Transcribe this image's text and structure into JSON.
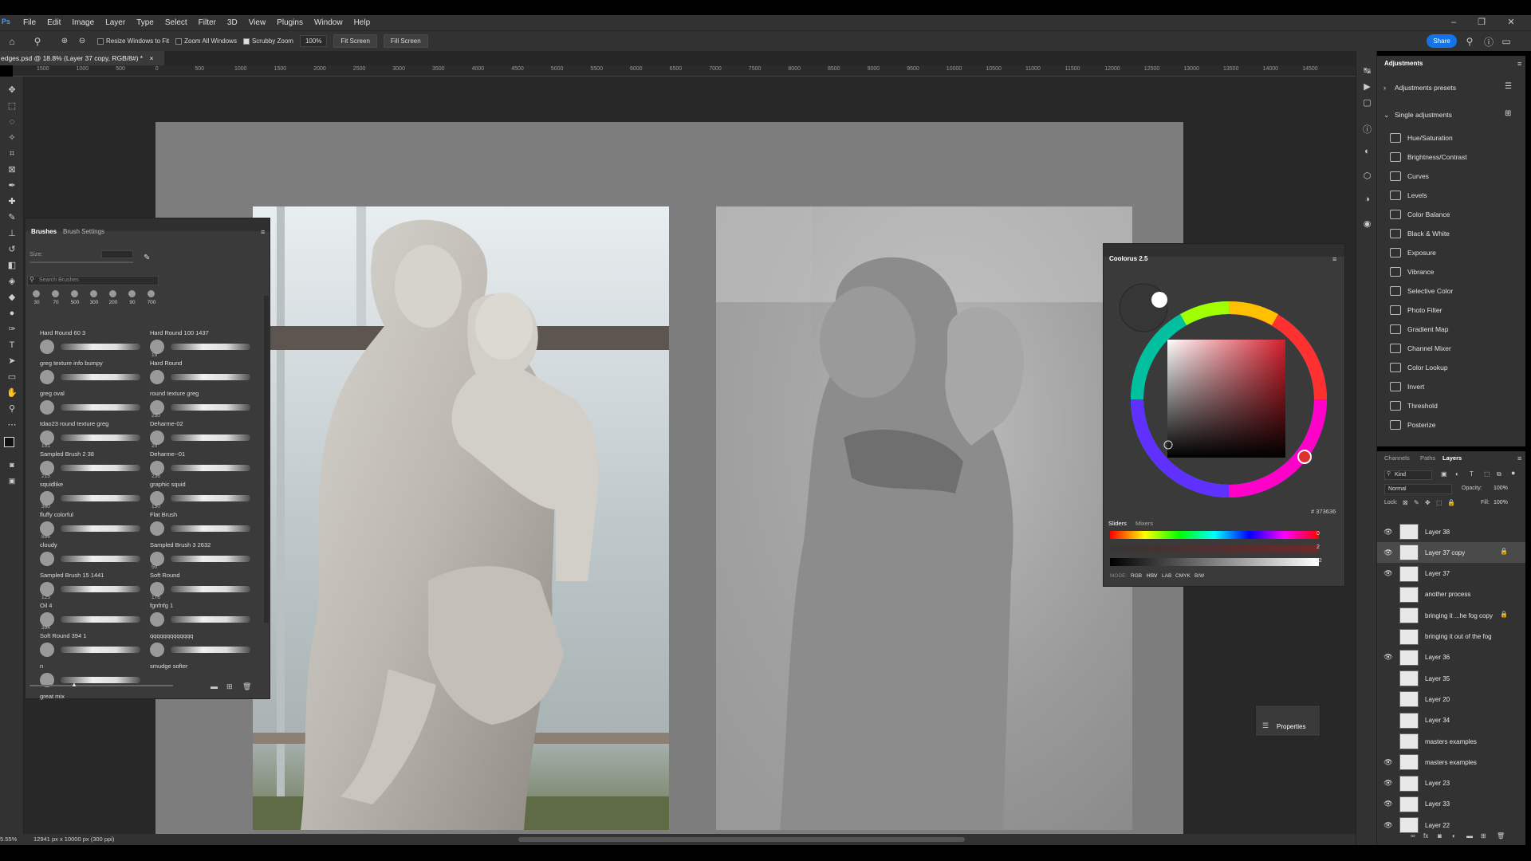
{
  "app": {
    "logo": "Ps",
    "menu": [
      "File",
      "Edit",
      "Image",
      "Layer",
      "Type",
      "Select",
      "Filter",
      "3D",
      "View",
      "Plugins",
      "Window",
      "Help"
    ],
    "window_controls": [
      "–",
      "❐",
      "✕"
    ]
  },
  "options_bar": {
    "resize_windows_label": "Resize Windows to Fit",
    "zoom_all_label": "Zoom All Windows",
    "scrubby_zoom_label": "Scrubby Zoom",
    "zoom_value": "100%",
    "fit_screen_label": "Fit Screen",
    "fill_screen_label": "Fill Screen",
    "share_label": "Share"
  },
  "document": {
    "tab_title": "edges.psd @ 18.8% (Layer 37 copy, RGB/8#) *",
    "close": "×"
  },
  "ruler": {
    "ticks": [
      "1500",
      "1000",
      "500",
      "0",
      "500",
      "1000",
      "1500",
      "2000",
      "2500",
      "3000",
      "3500",
      "4000",
      "4500",
      "5000",
      "5500",
      "6000",
      "6500",
      "7000",
      "7500",
      "8000",
      "8500",
      "9000",
      "9500",
      "10000",
      "10500",
      "11000",
      "11500",
      "12000",
      "12500",
      "13000",
      "13500",
      "14000",
      "14500"
    ]
  },
  "status": {
    "zoom": "5.55%",
    "doc_size": "12941 px x 10000 px (300 ppi)"
  },
  "brushes_panel": {
    "tabs": [
      "Brushes",
      "Brush Settings"
    ],
    "size_label": "Size:",
    "search_placeholder": "Search Brushes",
    "recent_sizes": [
      "30",
      "70",
      "500",
      "300",
      "200",
      "90",
      "700"
    ],
    "brushes_left": [
      {
        "label": "Hard Round 60 3",
        "size": ""
      },
      {
        "label": "greg texture info bumpy",
        "size": ""
      },
      {
        "label": "greg oval",
        "size": ""
      },
      {
        "label": "tdao23 round texture greg",
        "size": ""
      },
      {
        "label": "Sampled Brush 2 38",
        "size": "191"
      },
      {
        "label": "squidlike",
        "size": "215"
      },
      {
        "label": "fluffy colorful",
        "size": "380"
      },
      {
        "label": "cloudy",
        "size": "896"
      },
      {
        "label": "Sampled Brush 15 1441",
        "size": ""
      },
      {
        "label": "Oil 4",
        "size": "125"
      },
      {
        "label": "Soft Round 394 1",
        "size": "394"
      },
      {
        "label": "n",
        "size": ""
      },
      {
        "label": "great mix",
        "size": ""
      }
    ],
    "brushes_right": [
      {
        "label": "Hard Round 100 1437",
        "size": ""
      },
      {
        "label": "Hard Round",
        "size": "19"
      },
      {
        "label": "round texture greg",
        "size": ""
      },
      {
        "label": "Deharme-02",
        "size": "250"
      },
      {
        "label": "Deharme--01",
        "size": "20"
      },
      {
        "label": "graphic squid",
        "size": "236"
      },
      {
        "label": "Flat Brush",
        "size": "150"
      },
      {
        "label": "Sampled Brush 3 2632",
        "size": ""
      },
      {
        "label": "Soft Round",
        "size": "50"
      },
      {
        "label": "fgnfnfg 1",
        "size": "176"
      },
      {
        "label": "qqqqqqqqqqqqq",
        "size": ""
      },
      {
        "label": "smudge softer",
        "size": ""
      }
    ]
  },
  "colour_panel": {
    "title": "Coolorus 2.5",
    "hex": "# 373636",
    "tabs": [
      "Sliders",
      "Mixers"
    ],
    "slider_values": [
      "0",
      "2",
      "22"
    ],
    "modes_label": "MODE:",
    "modes": [
      "RGB",
      "HSV",
      "LAB",
      "CMYK",
      "B/W"
    ],
    "accent": "#e03030"
  },
  "properties": {
    "label": "Properties"
  },
  "adjustments_panel": {
    "title": "Adjustments",
    "presets_label": "Adjustments presets",
    "single_label": "Single adjustments",
    "items": [
      "Hue/Saturation",
      "Brightness/Contrast",
      "Curves",
      "Levels",
      "Color Balance",
      "Black & White",
      "Exposure",
      "Vibrance",
      "Selective Color",
      "Photo Filter",
      "Gradient Map",
      "Channel Mixer",
      "Color Lookup",
      "Invert",
      "Threshold",
      "Posterize"
    ]
  },
  "layers_panel": {
    "tabs": [
      "Channels",
      "Paths",
      "Layers"
    ],
    "kind_label": "Kind",
    "blend_mode": "Normal",
    "opacity_label": "Opacity:",
    "opacity_value": "100%",
    "lock_label": "Lock:",
    "fill_label": "Fill:",
    "fill_value": "100%",
    "layers": [
      {
        "name": "Layer 38",
        "visible": true,
        "locked": false
      },
      {
        "name": "Layer 37 copy",
        "visible": true,
        "locked": true
      },
      {
        "name": "Layer 37",
        "visible": true,
        "locked": false
      },
      {
        "name": "another process",
        "visible": false,
        "locked": false
      },
      {
        "name": "bringing it ...he fog copy",
        "visible": false,
        "locked": true
      },
      {
        "name": "bringing it out of the fog",
        "visible": false,
        "locked": false
      },
      {
        "name": "Layer 36",
        "visible": true,
        "locked": false
      },
      {
        "name": "Layer 35",
        "visible": false,
        "locked": false
      },
      {
        "name": "Layer 20",
        "visible": false,
        "locked": false
      },
      {
        "name": "Layer 34",
        "visible": false,
        "locked": false
      },
      {
        "name": "masters examples",
        "visible": false,
        "locked": false
      },
      {
        "name": "masters examples",
        "visible": true,
        "locked": false
      },
      {
        "name": "Layer 23",
        "visible": true,
        "locked": false
      },
      {
        "name": "Layer 33",
        "visible": true,
        "locked": false
      },
      {
        "name": "Layer 22",
        "visible": true,
        "locked": false
      }
    ]
  }
}
